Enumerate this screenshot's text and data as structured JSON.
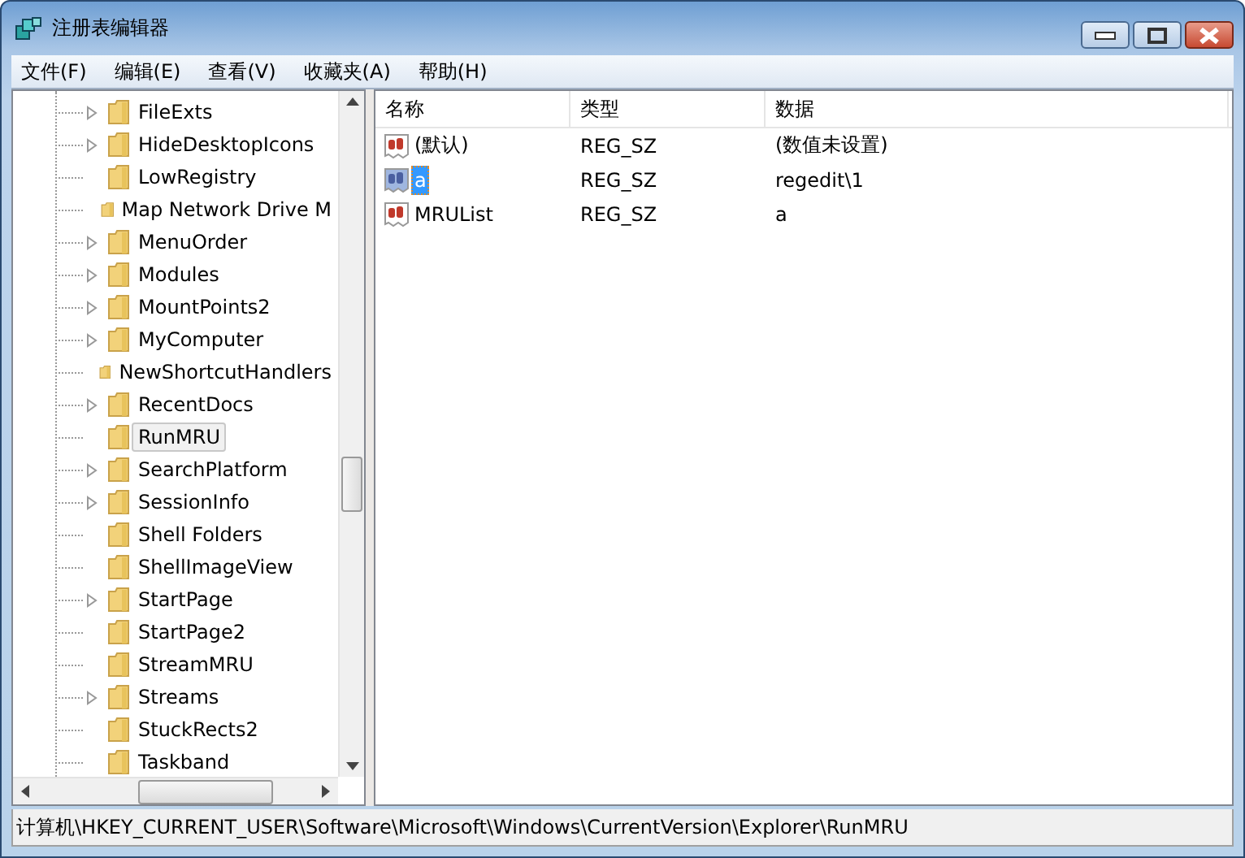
{
  "window": {
    "title": "注册表编辑器"
  },
  "menu": [
    "文件(F)",
    "编辑(E)",
    "查看(V)",
    "收藏夹(A)",
    "帮助(H)"
  ],
  "tree": {
    "items": [
      {
        "label": "FileExts",
        "expandable": true,
        "selected": false
      },
      {
        "label": "HideDesktopIcons",
        "expandable": true,
        "selected": false
      },
      {
        "label": "LowRegistry",
        "expandable": false,
        "selected": false
      },
      {
        "label": "Map Network Drive M",
        "expandable": false,
        "selected": false
      },
      {
        "label": "MenuOrder",
        "expandable": true,
        "selected": false
      },
      {
        "label": "Modules",
        "expandable": true,
        "selected": false
      },
      {
        "label": "MountPoints2",
        "expandable": true,
        "selected": false
      },
      {
        "label": "MyComputer",
        "expandable": true,
        "selected": false
      },
      {
        "label": "NewShortcutHandlers",
        "expandable": false,
        "selected": false
      },
      {
        "label": "RecentDocs",
        "expandable": true,
        "selected": false
      },
      {
        "label": "RunMRU",
        "expandable": false,
        "selected": true
      },
      {
        "label": "SearchPlatform",
        "expandable": true,
        "selected": false
      },
      {
        "label": "SessionInfo",
        "expandable": true,
        "selected": false
      },
      {
        "label": "Shell Folders",
        "expandable": false,
        "selected": false
      },
      {
        "label": "ShellImageView",
        "expandable": false,
        "selected": false
      },
      {
        "label": "StartPage",
        "expandable": true,
        "selected": false
      },
      {
        "label": "StartPage2",
        "expandable": false,
        "selected": false
      },
      {
        "label": "StreamMRU",
        "expandable": false,
        "selected": false
      },
      {
        "label": "Streams",
        "expandable": true,
        "selected": false
      },
      {
        "label": "StuckRects2",
        "expandable": false,
        "selected": false
      },
      {
        "label": "Taskband",
        "expandable": false,
        "selected": false
      }
    ]
  },
  "values": {
    "columns": [
      "名称",
      "类型",
      "数据"
    ],
    "rows": [
      {
        "name": "(默认)",
        "type": "REG_SZ",
        "data": "(数值未设置)",
        "selected": false
      },
      {
        "name": "a",
        "type": "REG_SZ",
        "data": "regedit\\1",
        "selected": true
      },
      {
        "name": "MRUList",
        "type": "REG_SZ",
        "data": "a",
        "selected": false
      }
    ]
  },
  "status_bar": "计算机\\HKEY_CURRENT_USER\\Software\\Microsoft\\Windows\\CurrentVersion\\Explorer\\RunMRU"
}
